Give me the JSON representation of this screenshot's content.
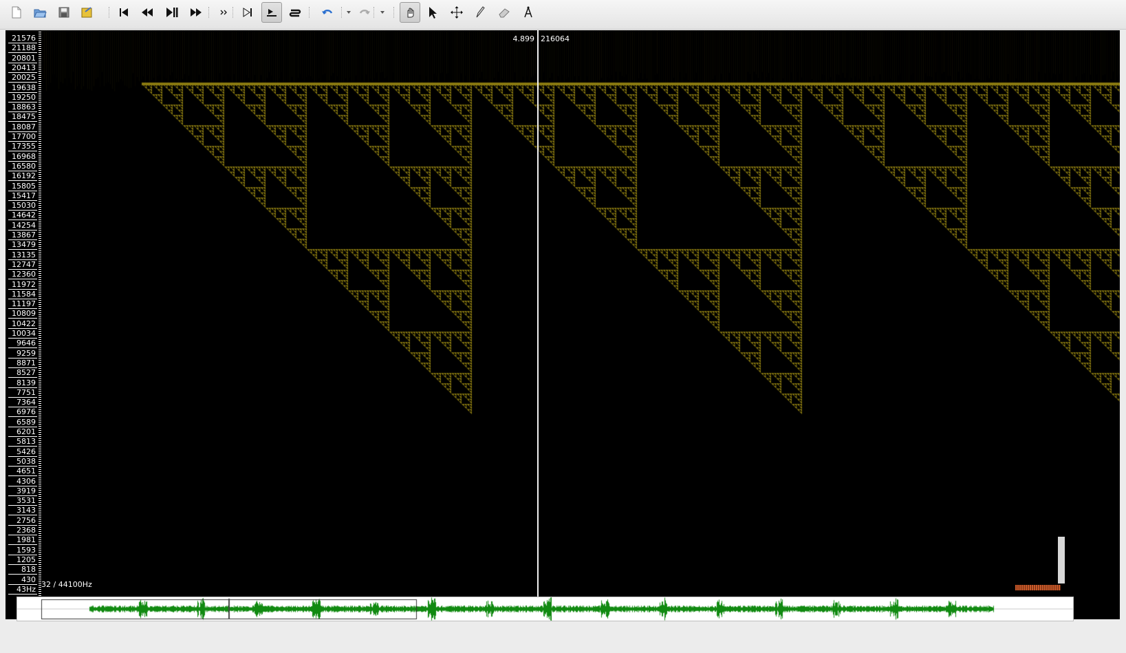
{
  "window": {
    "size": "1637x949"
  },
  "toolbar": {
    "buttons": [
      {
        "name": "new-file-icon",
        "title": "New"
      },
      {
        "name": "open-file-icon",
        "title": "Open"
      },
      {
        "name": "save-icon",
        "title": "Save"
      },
      {
        "name": "export-icon",
        "title": "Export"
      },
      {
        "name": "rewind-start-icon",
        "title": "Rewind to Start"
      },
      {
        "name": "rewind-icon",
        "title": "Rewind"
      },
      {
        "name": "play-pause-icon",
        "title": "Play / Pause"
      },
      {
        "name": "fast-forward-icon",
        "title": "Fast Forward"
      },
      {
        "name": "more-icon",
        "title": "More"
      },
      {
        "name": "skip-end-icon",
        "title": "Fast Forward to End"
      },
      {
        "name": "play-selection-icon",
        "title": "Constrain Playback to Selection",
        "active": true
      },
      {
        "name": "loop-icon",
        "title": "Loop"
      },
      {
        "name": "undo-icon",
        "title": "Undo"
      },
      {
        "name": "redo-icon",
        "title": "Redo"
      },
      {
        "name": "navigate-hand-icon",
        "title": "Navigate",
        "active": true
      },
      {
        "name": "select-arrow-icon",
        "title": "Select"
      },
      {
        "name": "move-icon",
        "title": "Edit"
      },
      {
        "name": "pencil-icon",
        "title": "Draw"
      },
      {
        "name": "eraser-icon",
        "title": "Erase"
      },
      {
        "name": "measure-icon",
        "title": "Measure"
      }
    ]
  },
  "spectrogram": {
    "freq_ticks": [
      "21576",
      "21188",
      "20801",
      "20413",
      "20025",
      "19638",
      "19250",
      "18863",
      "18475",
      "18087",
      "17700",
      "17355",
      "16968",
      "16580",
      "16192",
      "15805",
      "15417",
      "15030",
      "14642",
      "14254",
      "13867",
      "13479",
      "13135",
      "12747",
      "12360",
      "11972",
      "11584",
      "11197",
      "10809",
      "10422",
      "10034",
      "9646",
      "9259",
      "8871",
      "8527",
      "8139",
      "7751",
      "7364",
      "6976",
      "6589",
      "6201",
      "5813",
      "5426",
      "5038",
      "4651",
      "4306",
      "3919",
      "3531",
      "3143",
      "2756",
      "2368",
      "1981",
      "1593",
      "1205",
      "818",
      "430",
      "43Hz"
    ],
    "cursor_time": "4.899",
    "cursor_frame": "216064",
    "sample_rate_label": "32 / 44100Hz",
    "pattern_color": "#8a7a10"
  },
  "navigator": {
    "waveform_color": "#118a11"
  }
}
